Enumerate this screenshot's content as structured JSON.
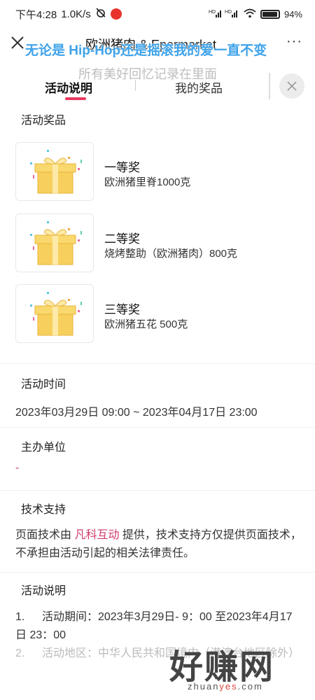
{
  "status_bar": {
    "time": "下午4:28",
    "speed": "1.0K/s",
    "battery": "94%",
    "icons": [
      "alarm-off-icon",
      "app-badge-icon",
      "hd-signal-icon",
      "wifi-icon",
      "battery-icon"
    ]
  },
  "title_bar": {
    "title": "欧洲猪肉 & Epermarket",
    "more": "···",
    "overlay_line1": "无论是 Hip-Hop还是摇滚我的爱一直不变",
    "overlay_line2": "所有美好回忆记录在里面"
  },
  "tabs": {
    "active": "活动说明",
    "other": "我的奖品"
  },
  "prizes_section": {
    "title": "活动奖品",
    "items": [
      {
        "level": "一等奖",
        "name": "欧洲猪里脊1000克"
      },
      {
        "level": "二等奖",
        "name": "烧烤整助（欧洲猪肉）800克"
      },
      {
        "level": "三等奖",
        "name": "欧洲猪五花 500克"
      }
    ]
  },
  "time_section": {
    "title": "活动时间",
    "value": "2023年03月29日 09:00 ~ 2023年04月17日 23:00"
  },
  "organizer_section": {
    "title": "主办单位",
    "value": "-"
  },
  "tech_section": {
    "title": "技术支持",
    "text_before": "页面技术由 ",
    "brand": "凡科互动",
    "text_after": " 提供，技术支持方仅提供页面技术，不承担由活动引起的相关法律责任。"
  },
  "desc_section": {
    "title": "活动说明",
    "items": [
      {
        "num": "1.",
        "text": "活动期间：2023年3月29日- 9：00 至2023年4月17日  23：00"
      },
      {
        "num": "2.",
        "text": "活动地区：中华人民共和国境内（港澳台地区除外）"
      }
    ]
  },
  "watermark": {
    "big": "好赚网",
    "small_prefix": "zhuan",
    "small_highlight": "yes",
    "small_suffix": ".com"
  },
  "colors": {
    "accent": "#e8395f",
    "brand_link": "#d23b6a",
    "overlay_blue": "#3fa3ea",
    "section_highlight": "#fde3e8"
  }
}
